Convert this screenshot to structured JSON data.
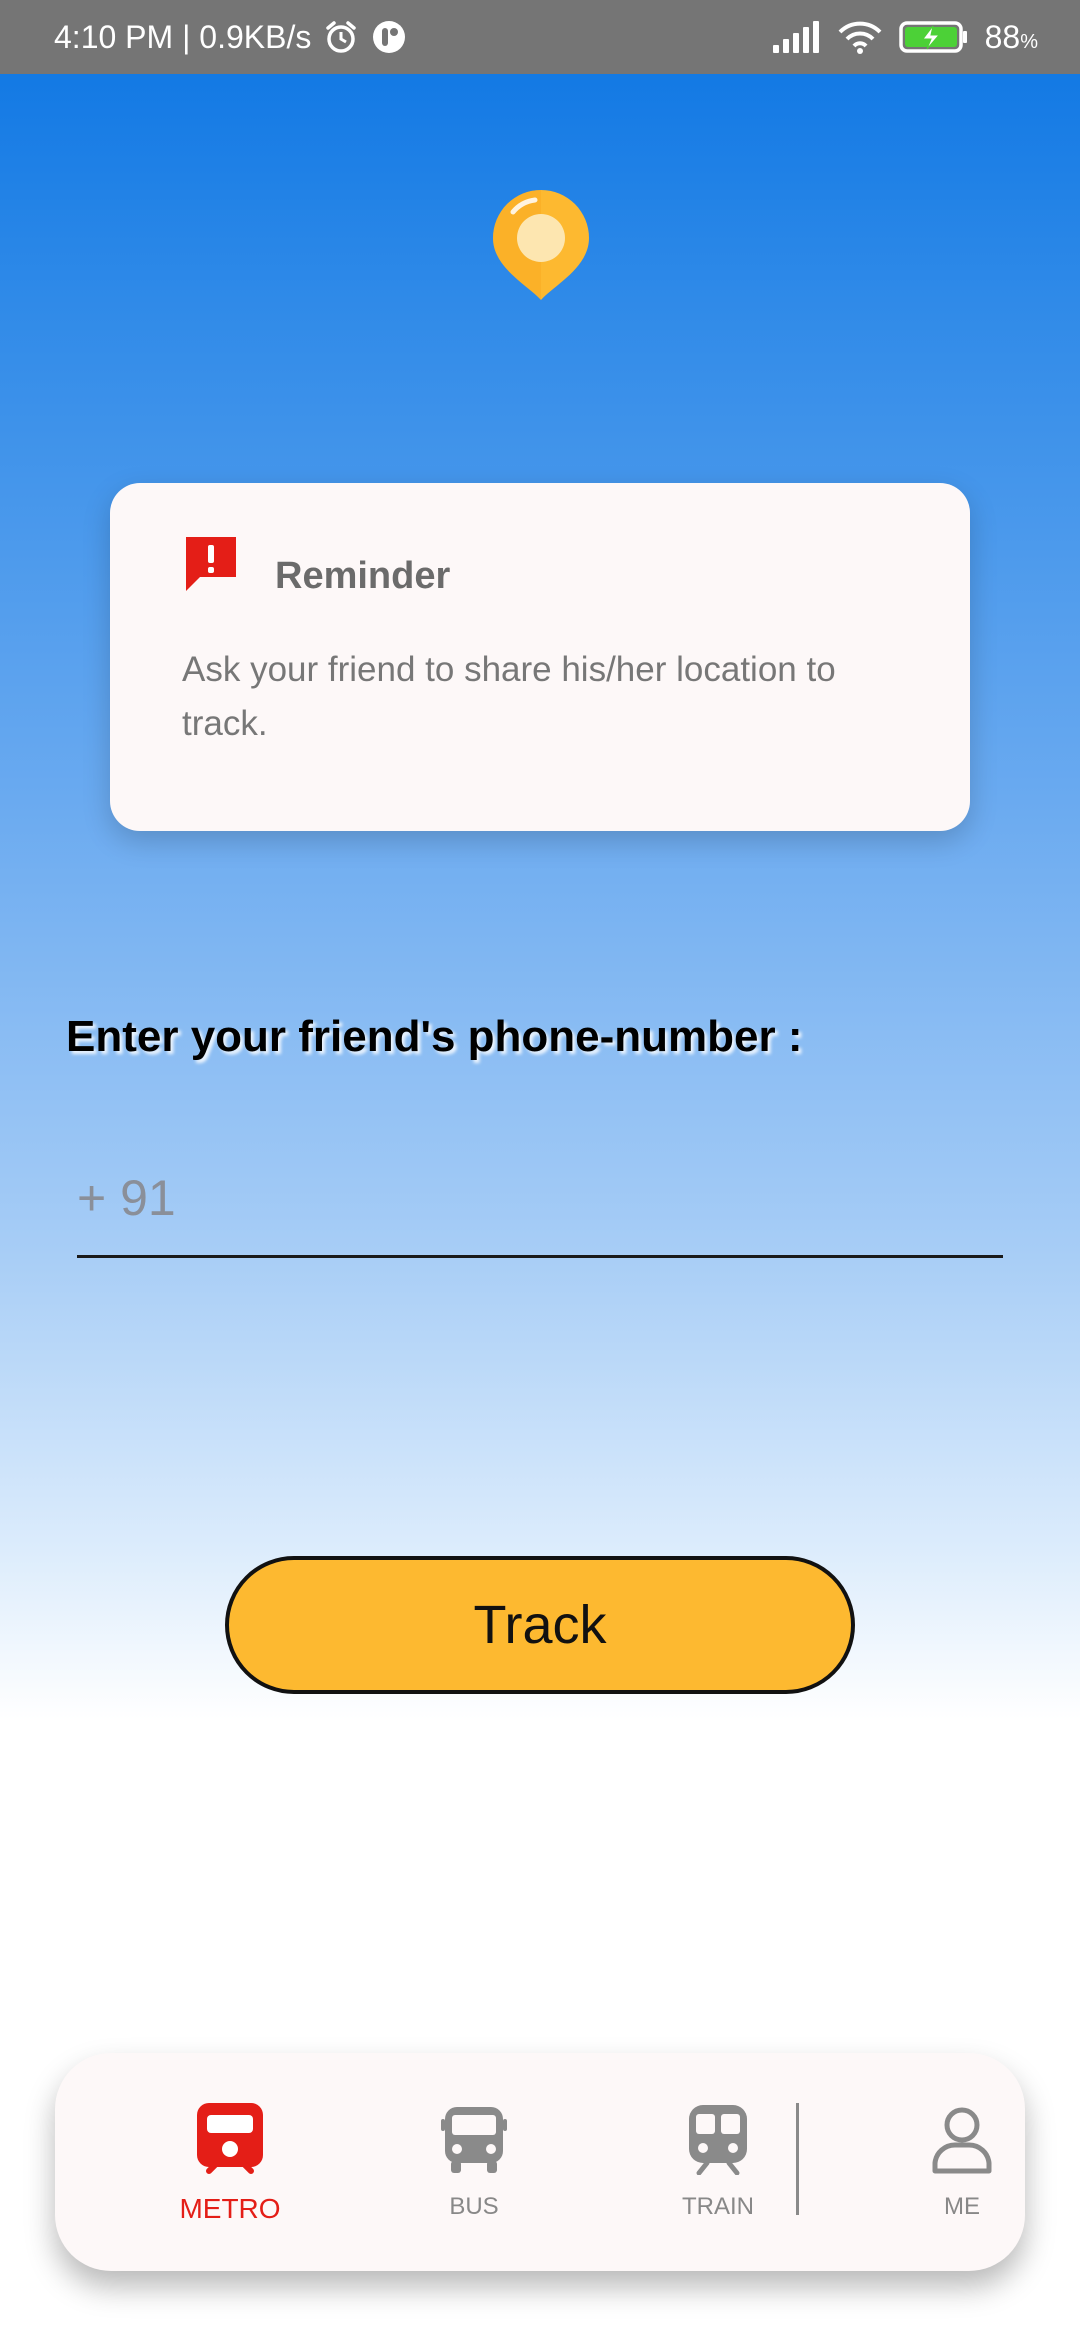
{
  "status_bar": {
    "time_speed": "4:10 PM | 0.9KB/s",
    "battery_percent": "88",
    "battery_unit": "%",
    "icons": [
      "alarm-icon",
      "app-notification-icon",
      "signal-icon",
      "wifi-icon",
      "battery-charging-icon"
    ]
  },
  "header": {
    "icon": "location-pin-icon"
  },
  "reminder": {
    "title": "Reminder",
    "body": "Ask your friend to share his/her location to track.",
    "icon": "alert-bubble-icon",
    "icon_color": "#e41e17"
  },
  "phone": {
    "label": "Enter your friend's phone-number :",
    "placeholder": "+ 91",
    "value": ""
  },
  "track_button": {
    "label": "Track",
    "color": "#fdb930"
  },
  "bottom_nav": {
    "items": [
      {
        "label": "METRO",
        "icon": "metro-icon",
        "active": true
      },
      {
        "label": "BUS",
        "icon": "bus-icon",
        "active": false
      },
      {
        "label": "TRAIN",
        "icon": "train-icon",
        "active": false
      },
      {
        "label": "ME",
        "icon": "person-icon",
        "active": false
      }
    ],
    "active_color": "#e41e17",
    "inactive_color": "#888888"
  }
}
